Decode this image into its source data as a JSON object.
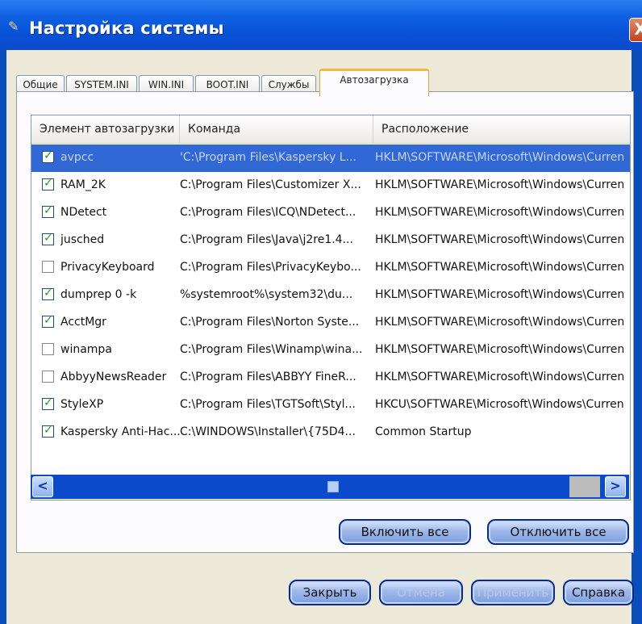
{
  "window": {
    "title": "Настройка системы",
    "close_glyph": "X",
    "icon": "settings-app-icon"
  },
  "tabs": [
    {
      "label": "Общие"
    },
    {
      "label": "SYSTEM.INI"
    },
    {
      "label": "WIN.INI"
    },
    {
      "label": "BOOT.INI"
    },
    {
      "label": "Службы"
    },
    {
      "label": "Автозагрузка",
      "active": true
    }
  ],
  "table": {
    "columns": [
      "Элемент автозагрузки",
      "Команда",
      "Расположение"
    ],
    "rows": [
      {
        "item": "avpcc",
        "command": "'C:\\Program Files\\Kaspersky L...",
        "location": "HKLM\\SOFTWARE\\Microsoft\\Windows\\Curren",
        "checked": true,
        "selected": true
      },
      {
        "item": "RAM_2K",
        "command": "C:\\Program Files\\Customizer X...",
        "location": "HKLM\\SOFTWARE\\Microsoft\\Windows\\Curren",
        "checked": true
      },
      {
        "item": "NDetect",
        "command": "C:\\Program Files\\ICQ\\NDetect...",
        "location": "HKLM\\SOFTWARE\\Microsoft\\Windows\\Curren",
        "checked": true
      },
      {
        "item": "jusched",
        "command": "C:\\Program Files\\Java\\j2re1.4...",
        "location": "HKLM\\SOFTWARE\\Microsoft\\Windows\\Curren",
        "checked": true
      },
      {
        "item": "PrivacyKeyboard",
        "command": "C:\\Program Files\\PrivacyKeybo...",
        "location": "HKLM\\SOFTWARE\\Microsoft\\Windows\\Curren",
        "checked": false
      },
      {
        "item": "dumprep 0 -k",
        "command": "%systemroot%\\system32\\du...",
        "location": "HKLM\\SOFTWARE\\Microsoft\\Windows\\Curren",
        "checked": true
      },
      {
        "item": "AcctMgr",
        "command": "C:\\Program Files\\Norton Syste...",
        "location": "HKLM\\SOFTWARE\\Microsoft\\Windows\\Curren",
        "checked": true
      },
      {
        "item": "winampa",
        "command": "C:\\Program Files\\Winamp\\wina...",
        "location": "HKLM\\SOFTWARE\\Microsoft\\Windows\\Curren",
        "checked": false
      },
      {
        "item": "AbbyyNewsReader",
        "command": "C:\\Program Files\\ABBYY FineR...",
        "location": "HKLM\\SOFTWARE\\Microsoft\\Windows\\Curren",
        "checked": false
      },
      {
        "item": "StyleXP",
        "command": "C:\\Program Files\\TGTSoft\\Styl...",
        "location": "HKCU\\SOFTWARE\\Microsoft\\Windows\\Curren",
        "checked": true
      },
      {
        "item": "Kaspersky Anti-Hac...",
        "command": "C:\\WINDOWS\\Installer\\{75D4...",
        "location": "Common Startup",
        "checked": true
      }
    ]
  },
  "scrollbar": {
    "left_glyph": "<",
    "right_glyph": ">"
  },
  "buttons": {
    "enable_all": "Включить все",
    "disable_all": "Отключить все",
    "close": "Закрыть",
    "cancel": "Отмена",
    "apply": "Применить",
    "help": "Справка"
  },
  "colors": {
    "titlebar": "#0851d6",
    "selection": "#3168d5",
    "active_tab_accent": "#f6b93e",
    "checkmark": "#21a121"
  }
}
